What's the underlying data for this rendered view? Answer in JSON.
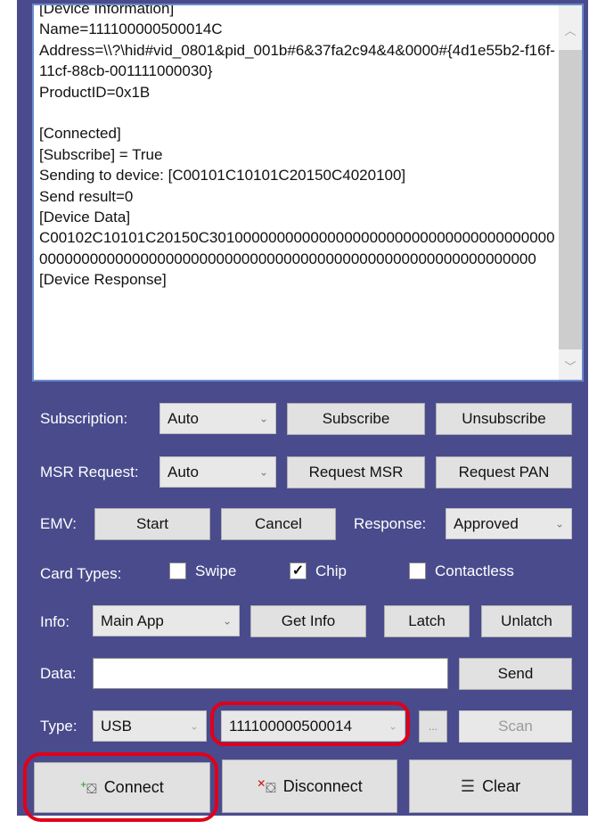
{
  "log": {
    "lines": [
      "[Device Information]",
      "Name=111100000500014C",
      "Address=\\\\?\\hid#vid_0801&pid_001b#6&37fa2c94&4&0000#{4d1e55b2-f16f-11cf-88cb-001111000030}",
      "ProductID=0x1B",
      "",
      "[Connected]",
      "[Subscribe] = True",
      "Sending to device: [C00101C10101C20150C4020100]",
      "Send result=0",
      "[Device Data]",
      "C00102C10101C20150C3010000000000000000000000000000000000000000000000000000000000000000000000000000000000000000000000000",
      "[Device Response]"
    ]
  },
  "subscription": {
    "label": "Subscription:",
    "mode": "Auto",
    "subscribe": "Subscribe",
    "unsubscribe": "Unsubscribe"
  },
  "msr": {
    "label": "MSR Request:",
    "mode": "Auto",
    "request_msr": "Request MSR",
    "request_pan": "Request PAN"
  },
  "emv": {
    "label": "EMV:",
    "start": "Start",
    "cancel": "Cancel",
    "response_label": "Response:",
    "response_value": "Approved"
  },
  "card_types": {
    "label": "Card Types:",
    "swipe": "Swipe",
    "swipe_checked": false,
    "chip": "Chip",
    "chip_checked": true,
    "contactless": "Contactless",
    "contactless_checked": false
  },
  "info": {
    "label": "Info:",
    "selected": "Main App",
    "get_info": "Get Info",
    "latch": "Latch",
    "unlatch": "Unlatch"
  },
  "data": {
    "label": "Data:",
    "value": "",
    "send": "Send"
  },
  "type": {
    "label": "Type:",
    "selected": "USB",
    "device": "111100000500014",
    "browse": "...",
    "scan": "Scan"
  },
  "actions": {
    "connect": "Connect",
    "disconnect": "Disconnect",
    "clear": "Clear"
  },
  "colors": {
    "panel": "#494b8d",
    "highlight": "#e0001b"
  }
}
